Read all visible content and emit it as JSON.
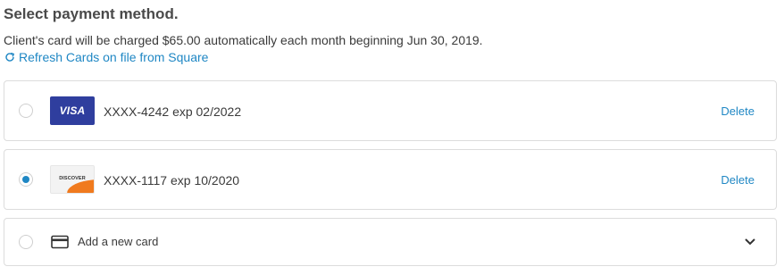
{
  "header": {
    "title": "Select payment method.",
    "subtitle": "Client's card will be charged $65.00 automatically each month beginning Jun 30, 2019.",
    "refresh_label": "Refresh Cards on file from Square",
    "refresh_icon": "refresh-icon"
  },
  "cards": [
    {
      "brand": "VISA",
      "brand_icon": "visa-logo",
      "number": "XXXX-4242",
      "exp": "exp 02/2022",
      "selected": false,
      "delete_label": "Delete"
    },
    {
      "brand": "DISCOVER",
      "brand_icon": "discover-logo",
      "number": "XXXX-1117",
      "exp": "exp 10/2020",
      "selected": true,
      "delete_label": "Delete"
    }
  ],
  "new_card": {
    "label": "Add a new card",
    "icon": "credit-card-icon",
    "selected": false,
    "expand_icon": "chevron-down-icon"
  },
  "colors": {
    "accent": "#1f87c4",
    "visa_blue": "#2f3e9e",
    "discover_orange": "#f07a1e",
    "border": "#dcdcdc"
  }
}
